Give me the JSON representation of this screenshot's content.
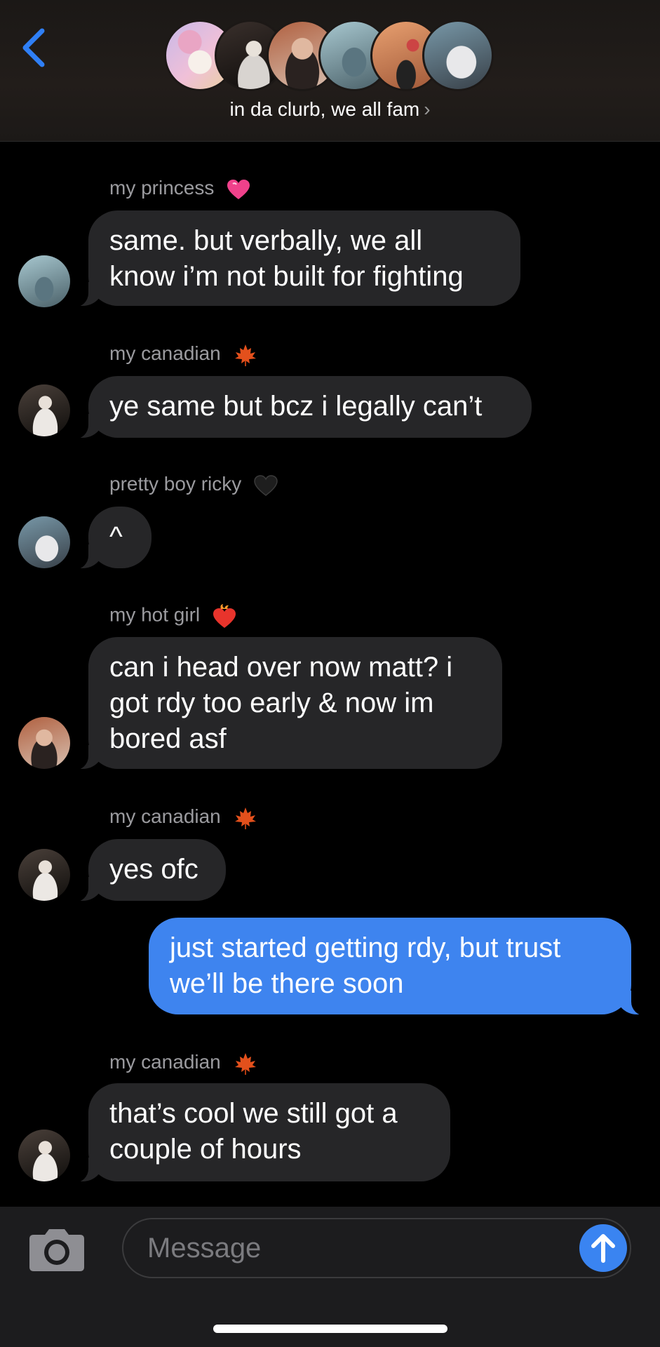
{
  "header": {
    "group_name": "in da clurb, we all fam",
    "chevron": "›",
    "back_icon": "chevron-left-icon"
  },
  "messages": [
    {
      "sender": "my princess",
      "emoji": "heart-icon",
      "text": [
        "same. but verbally, we all",
        "know i’m not built for fighting"
      ]
    },
    {
      "sender": "my canadian",
      "emoji": "maple-leaf-icon",
      "text": [
        "ye same but bcz i legally can’t"
      ]
    },
    {
      "sender": "pretty boy ricky",
      "emoji": "black-heart-icon",
      "text": [
        "^"
      ]
    },
    {
      "sender": "my hot girl",
      "emoji": "heart-on-fire-icon",
      "text": [
        "can i head over now matt? i",
        "got rdy too early & now im",
        "bored asf"
      ]
    },
    {
      "sender": "my canadian",
      "emoji": "maple-leaf-icon",
      "text": [
        "yes ofc"
      ]
    },
    {
      "sender": "me",
      "text": [
        "just started getting rdy, but trust",
        "we’ll be there soon"
      ]
    },
    {
      "sender": "my canadian",
      "emoji": "maple-leaf-icon",
      "text": [
        "that’s cool we still got a",
        "couple of hours"
      ]
    }
  ],
  "composer": {
    "placeholder": "Message",
    "camera_icon": "camera-icon",
    "send_icon": "arrow-up-icon"
  },
  "colors": {
    "incoming_bubble": "#262628",
    "outgoing_bubble": "#3e84ef",
    "accent": "#2f7ff5"
  }
}
